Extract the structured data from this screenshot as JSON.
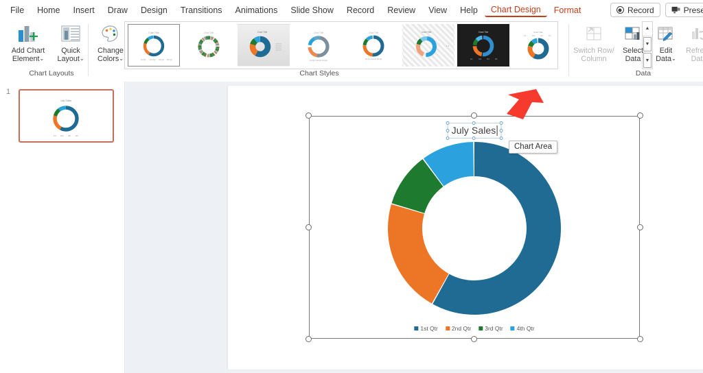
{
  "app": {
    "menu": [
      {
        "label": "File"
      },
      {
        "label": "Home"
      },
      {
        "label": "Insert"
      },
      {
        "label": "Draw"
      },
      {
        "label": "Design"
      },
      {
        "label": "Transitions"
      },
      {
        "label": "Animations"
      },
      {
        "label": "Slide Show"
      },
      {
        "label": "Record"
      },
      {
        "label": "Review"
      },
      {
        "label": "View"
      },
      {
        "label": "Help"
      }
    ],
    "contextual_tabs": [
      {
        "label": "Chart Design",
        "active": true
      },
      {
        "label": "Format",
        "active": false
      }
    ],
    "topright": [
      {
        "label": "Record",
        "icon": "record-circle-icon"
      },
      {
        "label": "Present",
        "icon": "present-icon"
      }
    ]
  },
  "ribbon": {
    "groups": [
      {
        "name": "Chart Layouts",
        "label": "Chart Layouts",
        "buttons": [
          {
            "label_line1": "Add Chart",
            "label_line2": "Element",
            "caret": "⌄",
            "icon": "add-chart-element-icon",
            "disabled": false
          },
          {
            "label_line1": "Quick",
            "label_line2": "Layout",
            "caret": "⌄",
            "icon": "quick-layout-icon",
            "disabled": false
          }
        ]
      },
      {
        "name": "Chart Styles",
        "label": "Chart Styles",
        "buttons": [
          {
            "label_line1": "Change",
            "label_line2": "Colors",
            "caret": "⌄",
            "icon": "change-colors-icon",
            "disabled": false
          }
        ],
        "gallery": [
          {
            "name": "style-1",
            "selected": true,
            "variant": "plain"
          },
          {
            "name": "style-2",
            "selected": false,
            "variant": "plain"
          },
          {
            "name": "style-3",
            "selected": false,
            "variant": "shaded"
          },
          {
            "name": "style-4",
            "selected": false,
            "variant": "plain"
          },
          {
            "name": "style-5",
            "selected": false,
            "variant": "plain"
          },
          {
            "name": "style-6",
            "selected": false,
            "variant": "hatch"
          },
          {
            "name": "style-7",
            "selected": false,
            "variant": "dark"
          },
          {
            "name": "style-8",
            "selected": false,
            "variant": "plain"
          }
        ],
        "scroll": {
          "up": "▲",
          "down": "▼",
          "more": "▼"
        }
      },
      {
        "name": "Data",
        "label": "Data",
        "buttons": [
          {
            "label_line1": "Switch Row/",
            "label_line2": "Column",
            "caret": "",
            "icon": "switch-row-column-icon",
            "disabled": true
          },
          {
            "label_line1": "Select",
            "label_line2": "Data",
            "caret": "",
            "icon": "select-data-icon",
            "disabled": false
          },
          {
            "label_line1": "Edit",
            "label_line2": "Data",
            "caret": "⌄",
            "icon": "edit-data-icon",
            "disabled": false
          },
          {
            "label_line1": "Refresh",
            "label_line2": "Data",
            "caret": "",
            "icon": "refresh-data-icon",
            "disabled": true
          }
        ]
      }
    ]
  },
  "thumbnails": {
    "slides": [
      {
        "number": "1",
        "selected": true
      }
    ]
  },
  "slide": {
    "chart": {
      "title": "July Sales",
      "title_editing": true,
      "tooltip": "Chart Area",
      "selected": true
    },
    "annotation": {
      "name": "red-arrow",
      "color": "#f63a2e"
    }
  },
  "chart_data": {
    "type": "pie",
    "subtype": "doughnut",
    "title": "July Sales",
    "categories": [
      "1st Qtr",
      "2nd Qtr",
      "3rd Qtr",
      "4th Qtr"
    ],
    "values": [
      58.2,
      21.5,
      10.3,
      10.0
    ],
    "colors": [
      "#1f6b94",
      "#ec7526",
      "#1d7a2e",
      "#2ba2dd"
    ],
    "legend_position": "bottom",
    "hole_ratio": 0.6,
    "start_angle": 0,
    "grid": false,
    "xlabel": "",
    "ylabel": ""
  }
}
